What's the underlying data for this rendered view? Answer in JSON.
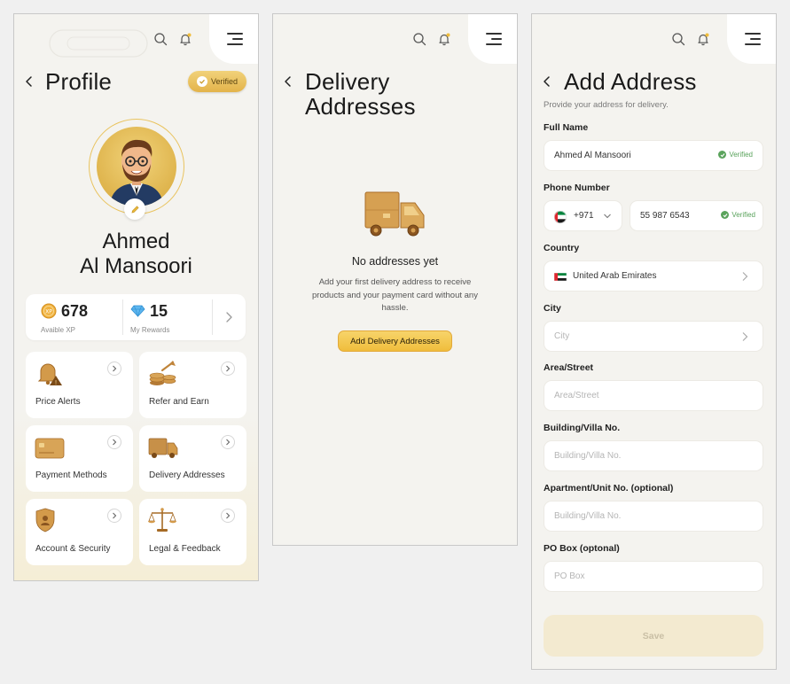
{
  "profile": {
    "title": "Profile",
    "verified_label": "Verified",
    "name_line1": "Ahmed",
    "name_line2": "Al Mansoori",
    "xp_value": "678",
    "xp_label": "Avaible XP",
    "rewards_value": "15",
    "rewards_label": "My Rewards",
    "menu": [
      {
        "label": "Price Alerts",
        "icon": "bell-icon"
      },
      {
        "label": "Refer and Earn",
        "icon": "coins-icon"
      },
      {
        "label": "Payment Methods",
        "icon": "card-icon"
      },
      {
        "label": "Delivery Addresses",
        "icon": "truck-icon"
      },
      {
        "label": "Account & Security",
        "icon": "shield-icon"
      },
      {
        "label": "Legal & Feedback",
        "icon": "scales-icon"
      }
    ]
  },
  "delivery": {
    "title_line1": "Delivery",
    "title_line2": "Addresses",
    "empty_title": "No addresses yet",
    "empty_desc": "Add your first delivery address to receive products and your payment card without any hassle.",
    "add_button": "Add Delivery Addresses"
  },
  "add_address": {
    "title": "Add Address",
    "subtitle": "Provide your address for delivery.",
    "full_name_label": "Full Name",
    "full_name_value": "Ahmed Al Mansoori",
    "verified_label": "Verified",
    "phone_label": "Phone Number",
    "country_code": "+971",
    "phone_value": "55 987 6543",
    "country_label": "Country",
    "country_value": "United Arab Emirates",
    "city_label": "City",
    "city_placeholder": "City",
    "area_label": "Area/Street",
    "area_placeholder": "Area/Street",
    "building_label": "Building/Villa No.",
    "building_placeholder": "Building/Villa No.",
    "apartment_label": "Apartment/Unit No. (optional)",
    "apartment_placeholder": "Building/Villa No.",
    "pobox_label": "PO Box (optonal)",
    "pobox_placeholder": "PO Box",
    "save_label": "Save"
  },
  "colors": {
    "accent_gold": "#f0bd3c",
    "verified_green": "#5aa35c",
    "background": "#f4f3ef"
  }
}
